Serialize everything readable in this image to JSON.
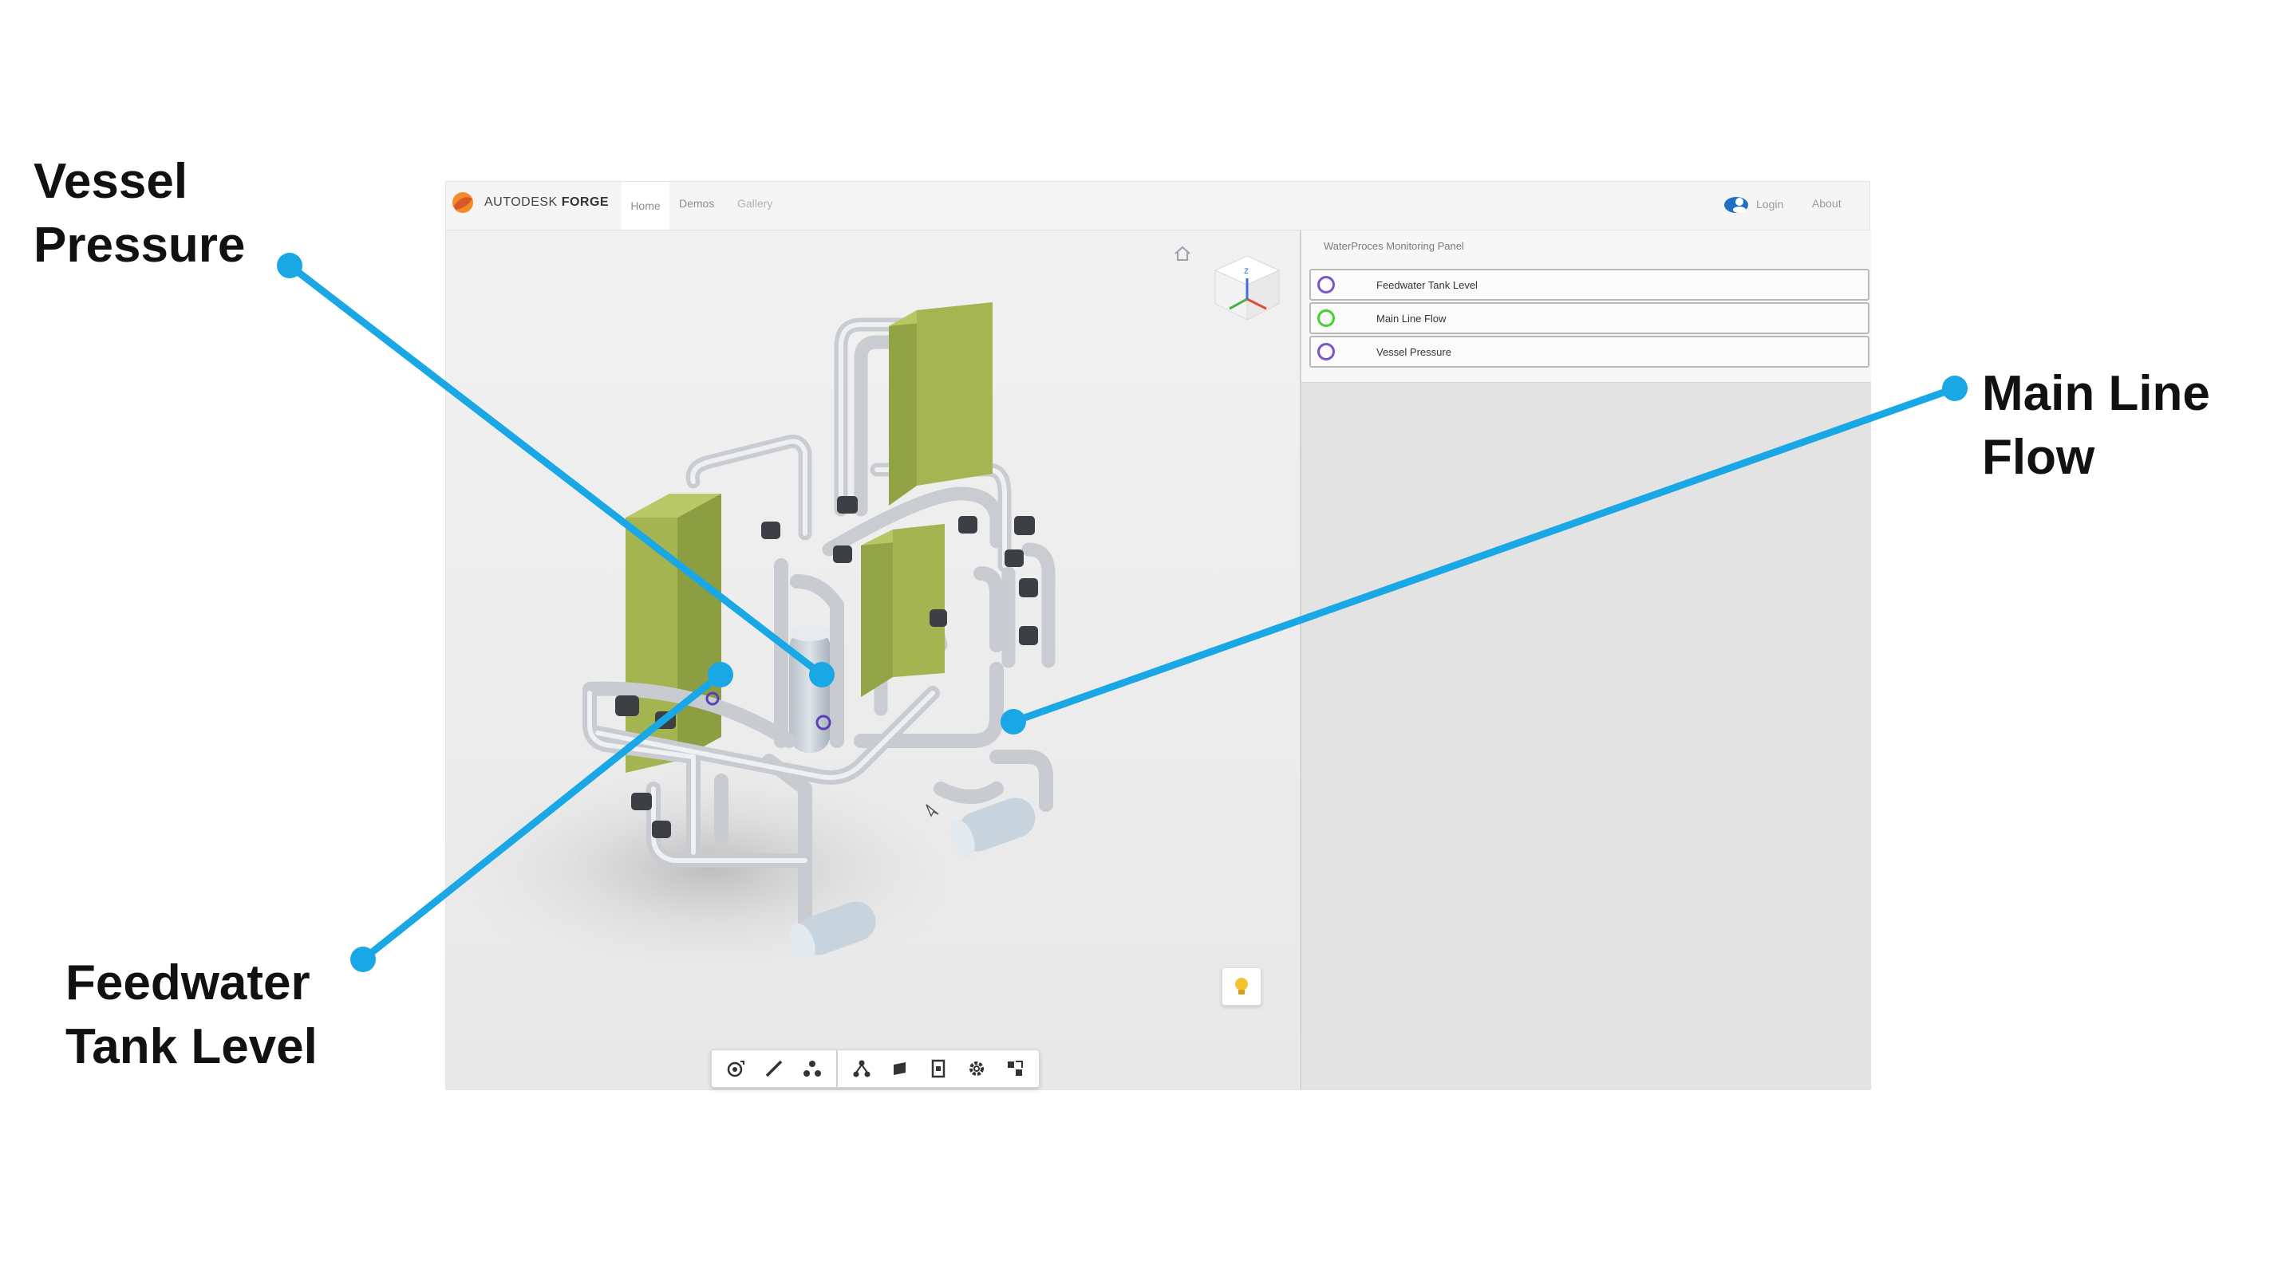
{
  "navbar": {
    "brand_prefix": "AUTODESK",
    "brand_name": "FORGE",
    "links": [
      "Home",
      "Demos",
      "Gallery"
    ],
    "login": "Login",
    "about": "About"
  },
  "panel": {
    "title": "WaterProces Monitoring Panel",
    "sensors": [
      {
        "label": "Feedwater Tank Level",
        "status_color": "#7b55c7"
      },
      {
        "label": "Main Line Flow",
        "status_color": "#43d12f"
      },
      {
        "label": "Vessel Pressure",
        "status_color": "#7b55c7"
      }
    ]
  },
  "callouts": {
    "vessel_pressure": [
      "Vessel",
      "Pressure"
    ],
    "main_line_flow": [
      "Main Line",
      "Flow"
    ],
    "feedwater_tank_level": [
      "Feedwater",
      "Tank Level"
    ]
  },
  "toolbar": {
    "tools": [
      "orbit-icon",
      "measure-icon",
      "explode-icon",
      "model-tree-icon",
      "layers-icon",
      "properties-icon",
      "settings-icon",
      "fullscreen-icon"
    ]
  },
  "colors": {
    "accent": "#1aa7e6",
    "tank_green": "#a3b451",
    "pipe": "#e2e4e6"
  }
}
